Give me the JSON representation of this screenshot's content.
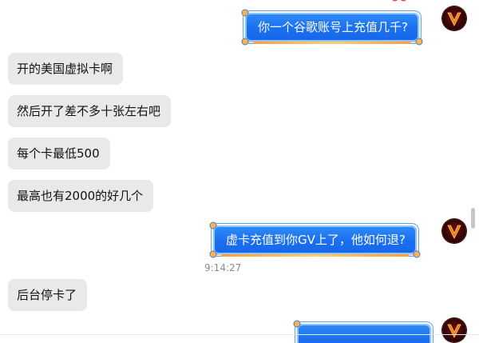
{
  "conversation": {
    "incoming": [
      {
        "text": "开的美国虚拟卡啊"
      },
      {
        "text": "然后开了差不多十张左右吧"
      },
      {
        "text": "每个卡最低500"
      },
      {
        "text": "最高也有2000的好几个"
      },
      {
        "text": "后台停卡了"
      }
    ],
    "outgoing": [
      {
        "text": "你一个谷歌账号上充值几千?"
      },
      {
        "text": "虚卡充值到你GV上了，他如何退?"
      },
      {
        "text": ""
      }
    ],
    "timestamp": "9:14:27"
  },
  "avatar": {
    "icon": "letter-v-avatar-icon",
    "letter": "V"
  },
  "colors": {
    "incoming_bubble": "#e9e9eb",
    "outgoing_bubble": "#1a6ff0",
    "frame_accent": "#ff9d3a",
    "timestamp": "#8a8a8a"
  }
}
